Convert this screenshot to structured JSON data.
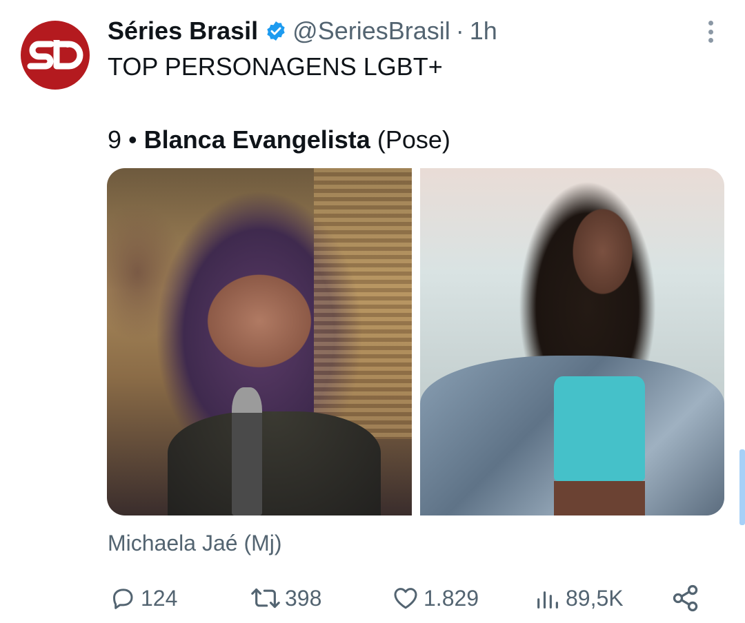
{
  "account": {
    "name": "Séries Brasil",
    "handle": "@SeriesBrasil",
    "separator": "·",
    "time": "1h",
    "avatar_text": "sb",
    "avatar_color": "#b41a1f",
    "verified_color": "#1d9bf0"
  },
  "tweet": {
    "text": "TOP PERSONAGENS LGBT+",
    "rank": "9",
    "bullet": "•",
    "character": "Blanca Evangelista",
    "show": "(Pose)",
    "caption": "Michaela Jaé (Mj)"
  },
  "media": [
    {
      "name": "photo-performer-singing"
    },
    {
      "name": "photo-performer-denim-jacket"
    }
  ],
  "actions": {
    "replies": "124",
    "retweets": "398",
    "likes": "1.829",
    "views": "89,5K"
  },
  "colors": {
    "text_primary": "#0f1419",
    "text_secondary": "#536471",
    "accent": "#1d9bf0"
  }
}
